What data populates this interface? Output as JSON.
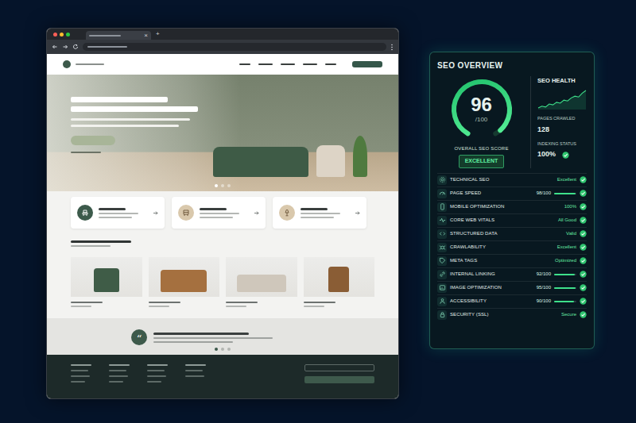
{
  "browser": {
    "tab_close": "×",
    "new_tab": "+"
  },
  "site": {
    "hero_slides": [
      {
        "selected": true
      },
      {
        "selected": false
      },
      {
        "selected": false
      }
    ],
    "quote_mark": "“",
    "testimonial_slides": [
      {
        "selected": true
      },
      {
        "selected": false
      },
      {
        "selected": false
      }
    ]
  },
  "seo": {
    "title": "SEO OVERVIEW",
    "score": "96",
    "score_max": "/100",
    "score_level": 0.96,
    "score_label": "OVERALL SEO SCORE",
    "grade": "EXCELLENT",
    "health_title": "SEO HEALTH",
    "health_trend": [
      18,
      22,
      20,
      27,
      25,
      31,
      29,
      36,
      34,
      41,
      45,
      43,
      52,
      58
    ],
    "pages_crawled_label": "PAGES CRAWLED",
    "pages_crawled": "128",
    "indexing_label": "INDEXING STATUS",
    "indexing": "100%",
    "indexing_ok": true,
    "metrics": [
      {
        "label": "TECHNICAL SEO",
        "value": "Excellent",
        "kind": "status",
        "ok": true
      },
      {
        "label": "PAGE SPEED",
        "value": "98/100",
        "kind": "bar",
        "level": 0.98,
        "ok": true
      },
      {
        "label": "MOBILE OPTIMIZATION",
        "value": "100%",
        "kind": "status",
        "ok": true
      },
      {
        "label": "CORE WEB VITALS",
        "value": "All Good",
        "kind": "status",
        "ok": true
      },
      {
        "label": "STRUCTURED DATA",
        "value": "Valid",
        "kind": "status",
        "ok": true
      },
      {
        "label": "CRAWLABILITY",
        "value": "Excellent",
        "kind": "status",
        "ok": true
      },
      {
        "label": "META TAGS",
        "value": "Optimized",
        "kind": "status",
        "ok": true
      },
      {
        "label": "INTERNAL LINKING",
        "value": "92/100",
        "kind": "bar",
        "level": 0.92,
        "ok": true
      },
      {
        "label": "IMAGE OPTIMIZATION",
        "value": "95/100",
        "kind": "bar",
        "level": 0.95,
        "ok": true
      },
      {
        "label": "ACCESSIBILITY",
        "value": "90/100",
        "kind": "bar",
        "level": 0.9,
        "ok": true
      },
      {
        "label": "SECURITY (SSL)",
        "value": "Secure",
        "kind": "status",
        "ok": true
      }
    ]
  }
}
